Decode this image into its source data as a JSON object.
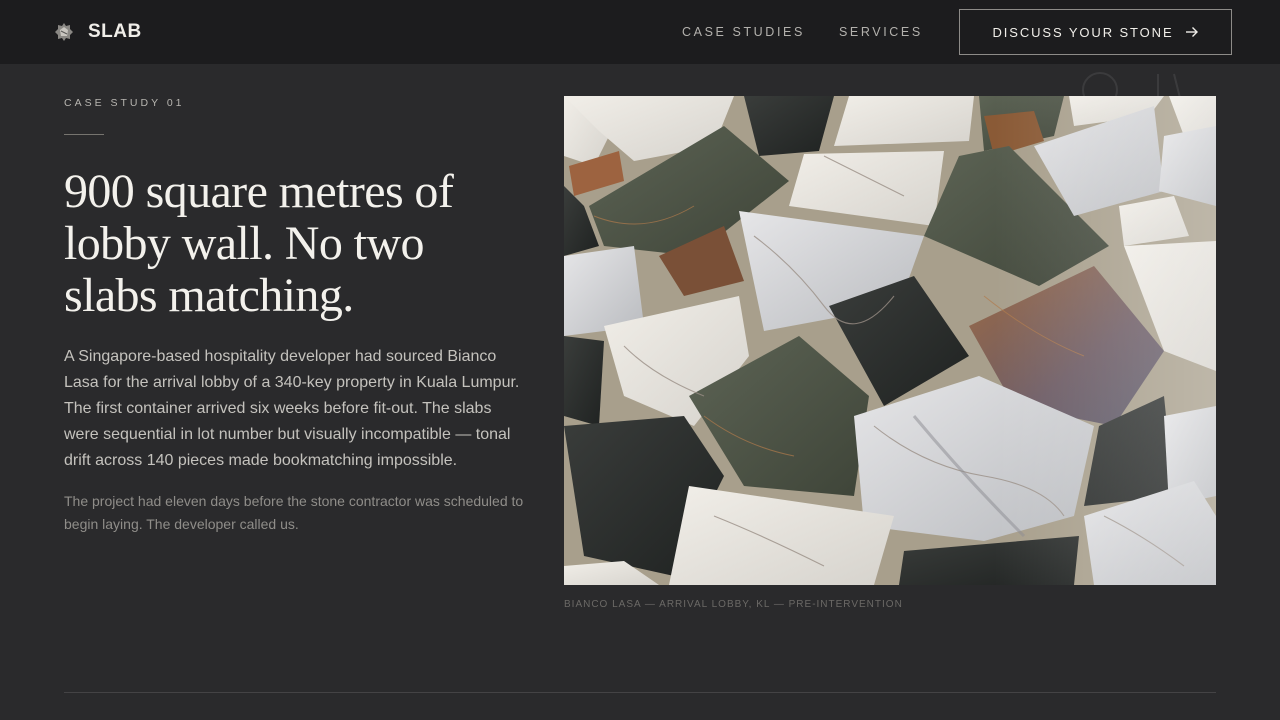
{
  "header": {
    "brand_name": "SLAB",
    "brand_icon": "stone-badge-icon",
    "nav": [
      {
        "label": "CASE STUDIES"
      },
      {
        "label": "SERVICES"
      }
    ],
    "cta_label": "DISCUSS YOUR STONE",
    "cta_icon": "arrow-right-icon"
  },
  "case": {
    "eyebrow": "CASE STUDY 01",
    "headline": "900 square metres of lobby wall. No two slabs matching.",
    "body_primary": "A Singapore-based hospitality developer had sourced Bianco Lasa for the arrival lobby of a 340-key property in Kuala Lumpur. The first container arrived six weeks before fit-out. The slabs were sequential in lot number but visually incompatible — tonal drift across 140 pieces made bookmatching impossible.",
    "body_secondary": "The project had eleven days before the stone contractor was scheduled to begin laying. The developer called us.",
    "image_caption": "BIANCO LASA — ARRIVAL LOBBY, KL — PRE-INTERVENTION"
  },
  "colors": {
    "background": "#2a2a2c",
    "topbar": "#1c1c1e",
    "text": "#f3f1ec"
  }
}
